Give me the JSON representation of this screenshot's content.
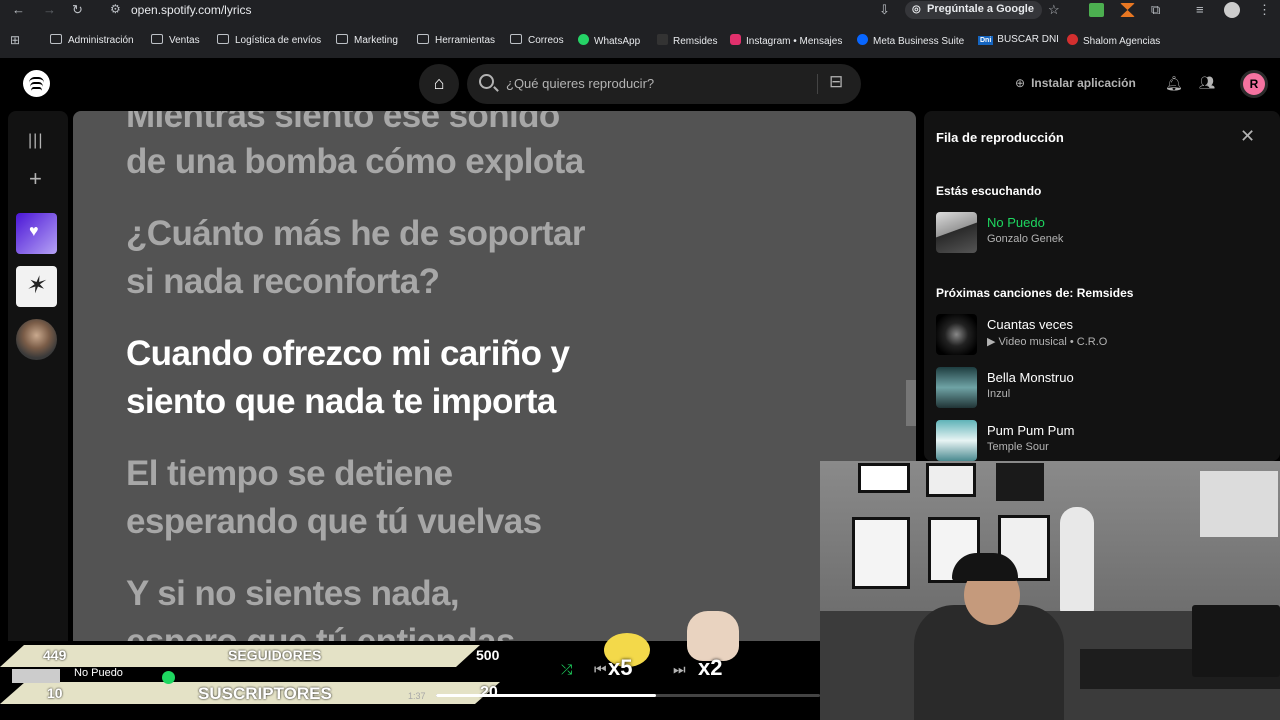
{
  "browser": {
    "url": "open.spotify.com/lyrics",
    "ask_google": "Pregúntale a Google",
    "bookmarks": [
      "Administración",
      "Ventas",
      "Logística de envíos",
      "Marketing",
      "Herramientas",
      "Correos",
      "WhatsApp",
      "Remsides",
      "Instagram • Mensajes",
      "Meta Business Suite",
      "BUSCAR DNI",
      "Shalom Agencias"
    ],
    "bookmark_dni_badge": "Dni"
  },
  "topbar": {
    "search_placeholder": "¿Qué quieres reproducir?",
    "install_label": "Instalar aplicación",
    "avatar_letter": "R",
    "accent": "#1ed760"
  },
  "lyrics": {
    "lines": [
      "Mientras siento ese sonido",
      "de una bomba cómo explota",
      "¿Cuánto más he de soportar",
      "si nada reconforta?",
      "Cuando ofrezco mi cariño y",
      "siento que nada te importa",
      "El tiempo se detiene",
      "esperando que tú vuelvas",
      "Y si no sientes nada,",
      "espero que tú entiendas"
    ]
  },
  "queue": {
    "title": "Fila de reproducción",
    "now_heading": "Estás escuchando",
    "now": {
      "name": "No Puedo",
      "artist": "Gonzalo Genek"
    },
    "next_heading": "Próximas canciones de: Remsides",
    "items": [
      {
        "name": "Cuantas veces",
        "sub": "Video musical • C.R.O"
      },
      {
        "name": "Bella Monstruo",
        "sub": "Inzul"
      },
      {
        "name": "Pum Pum Pum",
        "sub": "Temple Sour"
      }
    ]
  },
  "stream": {
    "followers_count": "449",
    "followers_label": "SEGUIDORES",
    "followers_goal": "500",
    "subs_count": "10",
    "subs_label": "SUSCRIPTORES",
    "subs_goal": "20",
    "mult1": "x5",
    "mult2": "x2",
    "player_track": "No Puedo",
    "elapsed": "1:37"
  }
}
